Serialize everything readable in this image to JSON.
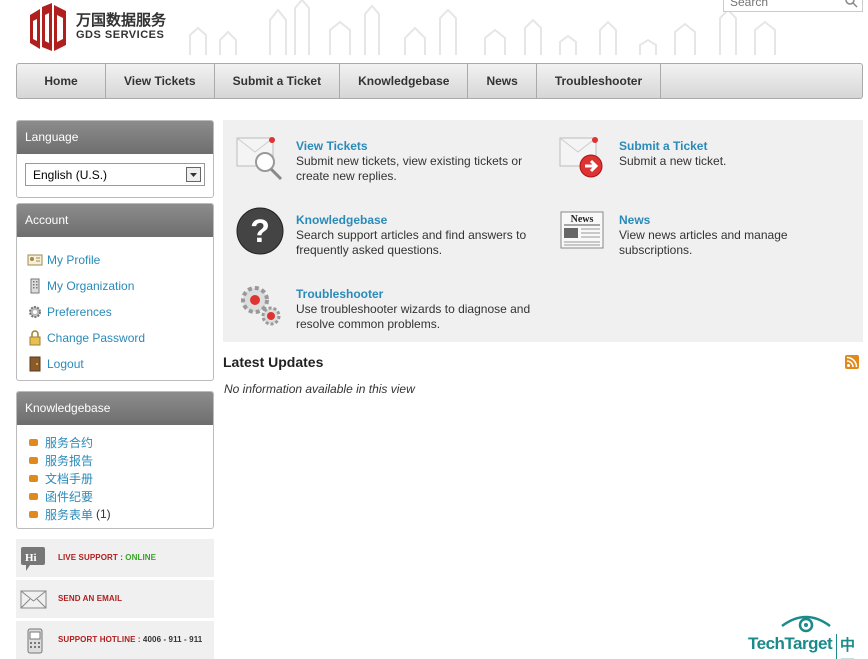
{
  "header": {
    "logo_cn": "万国数据服务",
    "logo_en": "GDS SERVICES",
    "search_placeholder": "Search"
  },
  "nav": {
    "items": [
      {
        "label": "Home"
      },
      {
        "label": "View Tickets"
      },
      {
        "label": "Submit a Ticket"
      },
      {
        "label": "Knowledgebase"
      },
      {
        "label": "News"
      },
      {
        "label": "Troubleshooter"
      }
    ]
  },
  "sidebar": {
    "language": {
      "title": "Language",
      "selected": "English (U.S.)"
    },
    "account": {
      "title": "Account",
      "items": [
        {
          "label": "My Profile",
          "icon": "profile-card-icon"
        },
        {
          "label": "My Organization",
          "icon": "building-icon"
        },
        {
          "label": "Preferences",
          "icon": "gear-icon"
        },
        {
          "label": "Change Password",
          "icon": "lock-icon"
        },
        {
          "label": "Logout",
          "icon": "door-icon"
        }
      ]
    },
    "knowledgebase": {
      "title": "Knowledgebase",
      "items": [
        {
          "label": "服务合约",
          "count": ""
        },
        {
          "label": "服务报告",
          "count": ""
        },
        {
          "label": "文档手册",
          "count": ""
        },
        {
          "label": "函件纪要",
          "count": ""
        },
        {
          "label": "服务表单",
          "count": "(1)"
        }
      ]
    },
    "support": {
      "live_label": "LIVE SUPPORT :",
      "live_status": "ONLINE",
      "email_label": "SEND AN EMAIL",
      "hotline_label": "SUPPORT HOTLINE :",
      "hotline_number": "4006 - 911 - 911",
      "hi_badge": "Hi"
    }
  },
  "main": {
    "tiles": [
      {
        "title": "View Tickets",
        "desc": "Submit new tickets, view existing tickets or create new replies.",
        "icon": "magnifier-document-icon"
      },
      {
        "title": "Submit a Ticket",
        "desc": "Submit a new ticket.",
        "icon": "submit-arrow-icon"
      },
      {
        "title": "Knowledgebase",
        "desc": "Search support articles and find answers to frequently asked questions.",
        "icon": "question-icon"
      },
      {
        "title": "News",
        "desc": "View news articles and manage subscriptions.",
        "icon": "newspaper-icon",
        "badge": "News"
      },
      {
        "title": "Troubleshooter",
        "desc": "Use troubleshooter wizards to diagnose and resolve common problems.",
        "icon": "gears-icon"
      }
    ],
    "latest_title": "Latest Updates",
    "no_info": "No information available in this view"
  },
  "footer": {
    "brand": "TechTarget",
    "brand_cn": "中国"
  },
  "colors": {
    "link": "#2a8ab8",
    "sidebar_header": "#7a7a7a",
    "panel_bg": "#f0f0f0",
    "brand_red": "#b01e1e",
    "accent_orange": "#e08a1e",
    "techtarget_teal": "#1b8a8a"
  }
}
